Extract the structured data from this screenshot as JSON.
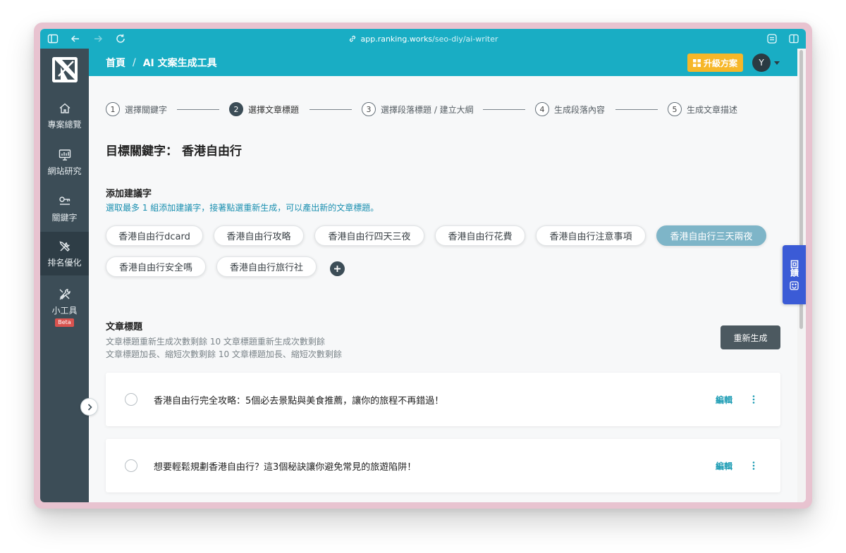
{
  "browser": {
    "url_host": "app.ranking.works",
    "url_path": "/seo-diy/ai-writer"
  },
  "sidebar": {
    "logo_icon": "ranking-works-logo",
    "items": [
      {
        "label": "專案總覽",
        "icon": "home-icon"
      },
      {
        "label": "網站研究",
        "icon": "monitor-chart-icon"
      },
      {
        "label": "關鍵字",
        "icon": "key-icon"
      },
      {
        "label": "排名優化",
        "icon": "tools-icon",
        "active": true
      },
      {
        "label": "小工具",
        "icon": "wrench-screwdriver-icon",
        "badge": "Beta"
      }
    ]
  },
  "header": {
    "breadcrumb_home": "首頁",
    "breadcrumb_sep": "/",
    "breadcrumb_current": "AI 文案生成工具",
    "upgrade_label": "升級方案",
    "avatar_initial": "Y"
  },
  "steps": [
    {
      "num": "1",
      "label": "選擇關鍵字"
    },
    {
      "num": "2",
      "label": "選擇文章標題",
      "active": true
    },
    {
      "num": "3",
      "label": "選擇段落標題 / 建立大綱"
    },
    {
      "num": "4",
      "label": "生成段落內容"
    },
    {
      "num": "5",
      "label": "生成文章描述"
    }
  ],
  "target_keyword": {
    "label": "目標關鍵字：",
    "value": "香港自由行"
  },
  "suggestions": {
    "title": "添加建議字",
    "hint": "選取最多 1 組添加建議字，接著點選重新生成，可以產出新的文章標題。",
    "chips": [
      "香港自由行dcard",
      "香港自由行攻略",
      "香港自由行四天三夜",
      "香港自由行花費",
      "香港自由行注意事項",
      "香港自由行三天兩夜",
      "香港自由行安全嗎",
      "香港自由行旅行社"
    ],
    "selected_chip": "香港自由行三天兩夜"
  },
  "titles_section": {
    "title": "文章標題",
    "quota_regen": "文章標題重新生成次數剩餘 10 文章標題重新生成次數剩餘",
    "quota_length": "文章標題加長、縮短次數剩餘 10 文章標題加長、縮短次數剩餘",
    "regen_label": "重新生成",
    "items": [
      {
        "text": "香港自由行完全攻略：5個必去景點與美食推薦，讓你的旅程不再錯過！",
        "edit_label": "編輯"
      },
      {
        "text": "想要輕鬆規劃香港自由行？這3個秘訣讓你避免常見的旅遊陷阱！",
        "edit_label": "編輯"
      }
    ]
  },
  "feedback": {
    "label": "回饋"
  }
}
